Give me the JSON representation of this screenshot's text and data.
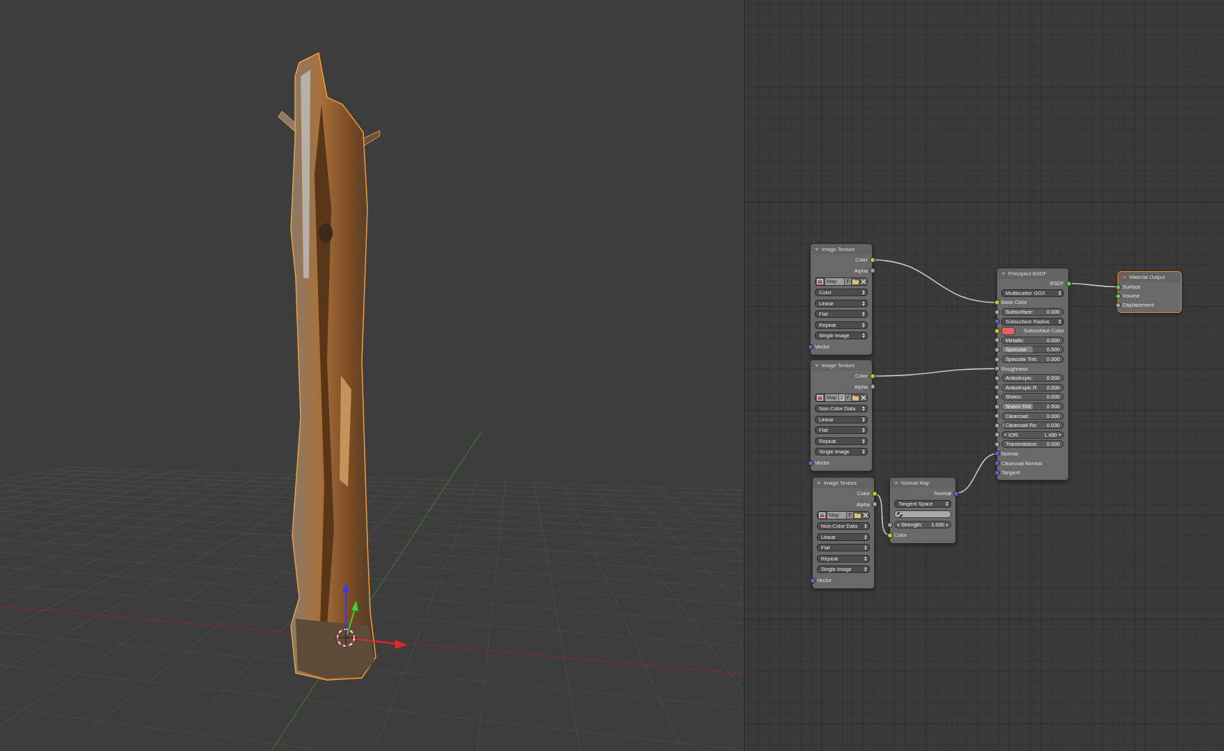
{
  "viewport": {
    "object_selected": true
  },
  "node_editor": {
    "nodes": [
      {
        "kind": "image_texture",
        "title": "Image Texture",
        "selected": false,
        "rows": [
          {
            "kind": "output",
            "label": "Color",
            "socket": {
              "kind": "color"
            }
          },
          {
            "kind": "output",
            "label": "Alpha",
            "socket": {
              "kind": "float"
            }
          },
          {
            "kind": "image_bar",
            "buttons": [
              {
                "kind": "name",
                "label": "Map"
              },
              {
                "kind": "fake_user",
                "label": "F"
              }
            ]
          },
          {
            "kind": "dropdown",
            "value": "Color"
          },
          {
            "kind": "dropdown",
            "value": "Linear"
          },
          {
            "kind": "dropdown",
            "value": "Flat"
          },
          {
            "kind": "dropdown",
            "value": "Repeat"
          },
          {
            "kind": "dropdown",
            "value": "Single Image"
          },
          {
            "kind": "input",
            "label": "Vector",
            "socket": {
              "kind": "vector"
            }
          }
        ]
      },
      {
        "kind": "image_texture",
        "title": "Image Texture",
        "selected": false,
        "rows": [
          {
            "kind": "output",
            "label": "Color",
            "socket": {
              "kind": "color"
            }
          },
          {
            "kind": "output",
            "label": "Alpha",
            "socket": {
              "kind": "float"
            }
          },
          {
            "kind": "image_bar",
            "buttons": [
              {
                "kind": "name",
                "label": "Map"
              },
              {
                "kind": "users",
                "label": "2"
              },
              {
                "kind": "fake_user",
                "label": "F"
              }
            ]
          },
          {
            "kind": "dropdown",
            "value": "Non-Color Data"
          },
          {
            "kind": "dropdown",
            "value": "Linear"
          },
          {
            "kind": "dropdown",
            "value": "Flat"
          },
          {
            "kind": "dropdown",
            "value": "Repeat"
          },
          {
            "kind": "dropdown",
            "value": "Single Image"
          },
          {
            "kind": "input",
            "label": "Vector",
            "socket": {
              "kind": "vector"
            }
          }
        ]
      },
      {
        "kind": "image_texture",
        "title": "Image Texture",
        "selected": false,
        "rows": [
          {
            "kind": "output",
            "label": "Color",
            "socket": {
              "kind": "color"
            }
          },
          {
            "kind": "output",
            "label": "Alpha",
            "socket": {
              "kind": "float"
            }
          },
          {
            "kind": "image_bar",
            "buttons": [
              {
                "kind": "name",
                "label": "Map"
              },
              {
                "kind": "fake_user",
                "label": "F"
              }
            ]
          },
          {
            "kind": "dropdown",
            "value": "Non-Color Data"
          },
          {
            "kind": "dropdown",
            "value": "Linear"
          },
          {
            "kind": "dropdown",
            "value": "Flat"
          },
          {
            "kind": "dropdown",
            "value": "Repeat"
          },
          {
            "kind": "dropdown",
            "value": "Single Image"
          },
          {
            "kind": "input",
            "label": "Vector",
            "socket": {
              "kind": "vector"
            }
          }
        ]
      },
      {
        "kind": "normal_map",
        "title": "Normal Map",
        "selected": false,
        "rows": [
          {
            "kind": "output",
            "label": "Normal",
            "socket": {
              "kind": "vector"
            }
          },
          {
            "kind": "dropdown",
            "value": "Tangent Space"
          },
          {
            "kind": "uv_field"
          },
          {
            "kind": "number",
            "label": "Strength:",
            "value": "1.000",
            "socket": {
              "kind": "float"
            }
          },
          {
            "kind": "input",
            "label": "Color",
            "socket": {
              "kind": "color"
            }
          }
        ]
      },
      {
        "kind": "principled_bsdf",
        "title": "Principled BSDF",
        "selected": false,
        "rows": [
          {
            "kind": "output",
            "label": "BSDF",
            "socket": {
              "kind": "shader"
            }
          },
          {
            "kind": "dropdown",
            "value": "Multiscatter GGX"
          },
          {
            "kind": "input",
            "label": "Base Color",
            "socket": {
              "kind": "color"
            }
          },
          {
            "kind": "slider",
            "label": "Subsurface:",
            "value": "0.000",
            "level": 0,
            "socket": {
              "kind": "float"
            }
          },
          {
            "kind": "dropdown",
            "value": "Subsurface Radius",
            "socket": {
              "kind": "vector"
            }
          },
          {
            "kind": "color_input",
            "label": "Subsurface Color",
            "color": "#e06262",
            "socket": {
              "kind": "color"
            }
          },
          {
            "kind": "slider",
            "label": "Metallic:",
            "value": "0.000",
            "level": 0,
            "socket": {
              "kind": "float"
            }
          },
          {
            "kind": "slider",
            "label": "Specular:",
            "value": "0.500",
            "level": 0.5,
            "socket": {
              "kind": "float"
            }
          },
          {
            "kind": "slider",
            "label": "Specular Tint:",
            "value": "0.000",
            "level": 0,
            "socket": {
              "kind": "float"
            }
          },
          {
            "kind": "input",
            "label": "Roughness",
            "socket": {
              "kind": "float"
            }
          },
          {
            "kind": "slider",
            "label": "Anisotropic:",
            "value": "0.000",
            "level": 0,
            "socket": {
              "kind": "float"
            }
          },
          {
            "kind": "slider",
            "label": "Anisotropic R:",
            "value": "0.000",
            "level": 0,
            "socket": {
              "kind": "float"
            }
          },
          {
            "kind": "slider",
            "label": "Sheen:",
            "value": "0.000",
            "level": 0,
            "socket": {
              "kind": "float"
            }
          },
          {
            "kind": "slider",
            "label": "Sheen Tint:",
            "value": "0.500",
            "level": 0.5,
            "socket": {
              "kind": "float"
            }
          },
          {
            "kind": "slider",
            "label": "Clearcoat:",
            "value": "0.000",
            "level": 0,
            "socket": {
              "kind": "float"
            }
          },
          {
            "kind": "slider",
            "label": "Clearcoat Ro:",
            "value": "0.030",
            "level": 0.03,
            "socket": {
              "kind": "float"
            }
          },
          {
            "kind": "number",
            "label": "IOR:",
            "value": "1.450",
            "socket": {
              "kind": "float"
            }
          },
          {
            "kind": "slider",
            "label": "Transmission:",
            "value": "0.000",
            "level": 0,
            "socket": {
              "kind": "float"
            }
          },
          {
            "kind": "input",
            "label": "Normal",
            "socket": {
              "kind": "vector"
            }
          },
          {
            "kind": "input",
            "label": "Clearcoat Normal",
            "socket": {
              "kind": "vector"
            }
          },
          {
            "kind": "input",
            "label": "Tangent",
            "socket": {
              "kind": "vector"
            }
          }
        ]
      },
      {
        "kind": "material_output",
        "title": "Material Output",
        "selected": true,
        "rows": [
          {
            "kind": "input",
            "label": "Surface",
            "socket": {
              "kind": "shader"
            }
          },
          {
            "kind": "input",
            "label": "Volume",
            "socket": {
              "kind": "shader"
            }
          },
          {
            "kind": "input",
            "label": "Displacement",
            "socket": {
              "kind": "float"
            }
          }
        ]
      }
    ]
  }
}
